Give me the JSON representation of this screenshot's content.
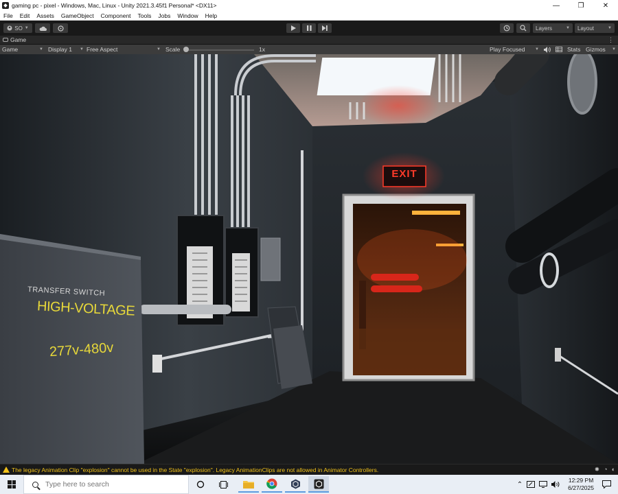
{
  "window": {
    "title": "gaming pc - pixel - Windows, Mac, Linux - Unity 2021.3.45f1 Personal* <DX11>",
    "minimize": "—",
    "maximize": "❐",
    "close": "✕"
  },
  "menu": [
    "File",
    "Edit",
    "Assets",
    "GameObject",
    "Component",
    "Tools",
    "Jobs",
    "Window",
    "Help"
  ],
  "toolbar": {
    "account_label": "SO",
    "layers_label": "Layers",
    "layout_label": "Layout"
  },
  "tab": {
    "label": "Game"
  },
  "gamebar": {
    "mode": "Game",
    "display": "Display 1",
    "aspect": "Free Aspect",
    "scale_label": "Scale",
    "scale_value": "1x",
    "play_mode": "Play Focused",
    "stats": "Stats",
    "gizmos": "Gizmos"
  },
  "scene": {
    "exit_sign": "EXIT",
    "panel_line1": "TRANSFER SWITCH",
    "panel_line2": "HIGH-VOLTAGE",
    "panel_line3": "277v-480v"
  },
  "console": {
    "message": "The legacy Animation Clip \"explosion\" cannot be used in the State \"explosion\". Legacy AnimationClips are not allowed in Animator Controllers."
  },
  "taskbar": {
    "search_placeholder": "Type here to search",
    "time": "12:29 PM",
    "date": "6/27/2025"
  },
  "colors": {
    "warning": "#f2c21a",
    "exit_red": "#ff2a1a",
    "panel_yellow": "#e7d83a"
  }
}
